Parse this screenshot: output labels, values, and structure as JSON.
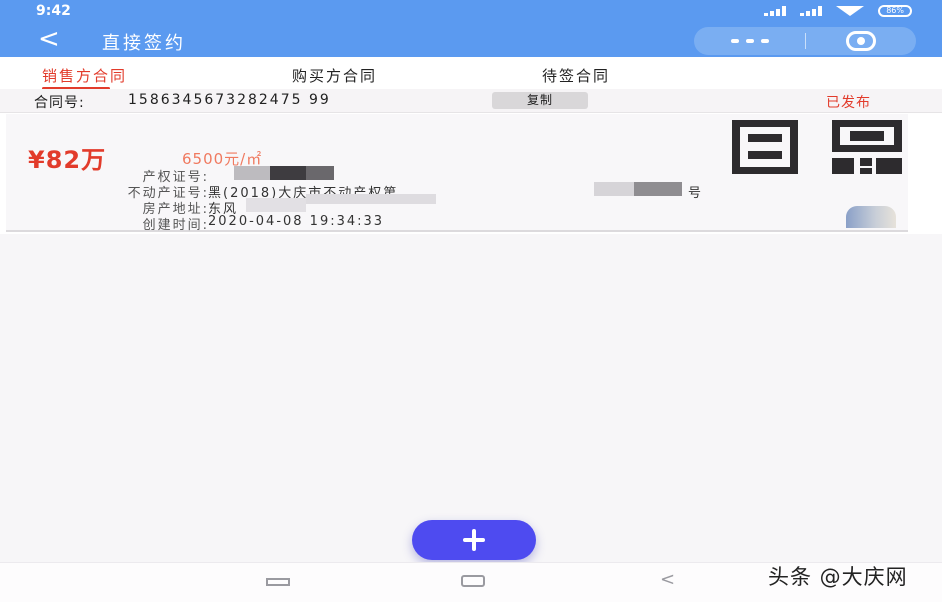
{
  "status_bar": {
    "time": "9:42",
    "battery": "86%"
  },
  "header": {
    "back_glyph": "<",
    "title": "直接签约",
    "more_glyph": "•••"
  },
  "tabs": [
    {
      "label": "销售方合同",
      "active": true
    },
    {
      "label": "购买方合同",
      "active": false
    },
    {
      "label": "待签合同",
      "active": false
    }
  ],
  "contract": {
    "number_label": "合同号:",
    "number_value": "1586345673282475 99",
    "copy_label": "复制",
    "status": "已发布"
  },
  "card": {
    "price": "¥82万",
    "unit_price": "6500元/㎡",
    "rows": [
      {
        "label": "产权证号:",
        "value": ""
      },
      {
        "label": "不动产证号:",
        "value": "黑(2018)大庆市不动产权第"
      },
      {
        "label": "房产地址:",
        "value": "东风"
      },
      {
        "label": "创建时间:",
        "value": "2020-04-08 19:34:33"
      }
    ],
    "row_suffix": "号"
  },
  "fab": {
    "icon": "plus-icon"
  },
  "navbar": {
    "back_glyph": "<"
  },
  "watermark": "头条 @大庆网",
  "colors": {
    "header": "#5b9af0",
    "accent": "#e23b2b",
    "fab": "#4e4bf0"
  }
}
